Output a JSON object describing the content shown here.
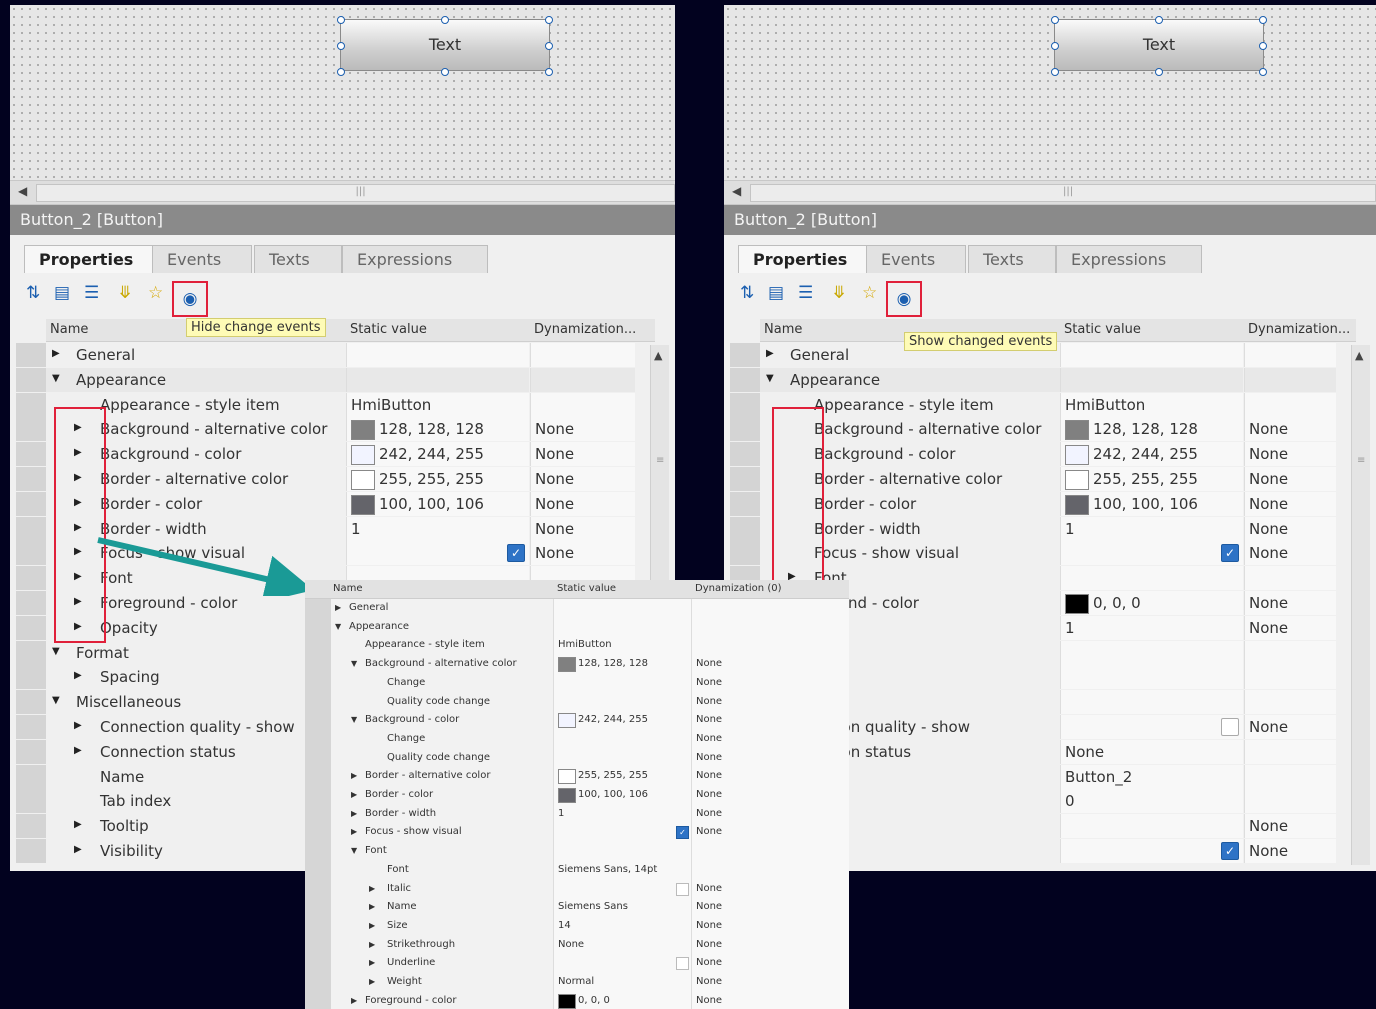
{
  "editor": {
    "widget_text": "Text",
    "title": "Button_2 [Button]",
    "tabs": [
      "Properties",
      "Events",
      "Texts",
      "Expressions"
    ],
    "columns": {
      "name": "Name",
      "static": "Static value",
      "dyn": "Dynamization..."
    }
  },
  "left": {
    "tooltip": "Hide change events",
    "rows": [
      {
        "indent": 0,
        "tri": "right",
        "name": "General",
        "swatch": "",
        "value": "",
        "check": "",
        "dyn": ""
      },
      {
        "indent": 0,
        "tri": "down",
        "name": "Appearance",
        "swatch": "",
        "value": "",
        "check": "",
        "dyn": "",
        "sel": true
      },
      {
        "indent": 1,
        "tri": "",
        "name": "Appearance - style item",
        "swatch": "",
        "value": "HmiButton",
        "check": "",
        "dyn": ""
      },
      {
        "indent": 1,
        "tri": "right",
        "name": "Background - alternative color",
        "swatch": "#808080",
        "value": "128, 128, 128",
        "check": "",
        "dyn": "None"
      },
      {
        "indent": 1,
        "tri": "right",
        "name": "Background - color",
        "swatch": "#f2f4ff",
        "value": "242, 244, 255",
        "check": "",
        "dyn": "None"
      },
      {
        "indent": 1,
        "tri": "right",
        "name": "Border - alternative color",
        "swatch": "#ffffff",
        "value": "255, 255, 255",
        "check": "",
        "dyn": "None"
      },
      {
        "indent": 1,
        "tri": "right",
        "name": "Border - color",
        "swatch": "#64646a",
        "value": "100, 100, 106",
        "check": "",
        "dyn": "None"
      },
      {
        "indent": 1,
        "tri": "right",
        "name": "Border - width",
        "swatch": "",
        "value": "1",
        "check": "",
        "dyn": "None"
      },
      {
        "indent": 1,
        "tri": "right",
        "name": "Focus - show visual",
        "swatch": "",
        "value": "",
        "check": "on",
        "dyn": "None"
      },
      {
        "indent": 1,
        "tri": "right",
        "name": "Font",
        "swatch": "",
        "value": "",
        "check": "",
        "dyn": ""
      },
      {
        "indent": 1,
        "tri": "right",
        "name": "Foreground - color",
        "swatch": "",
        "value": "",
        "check": "",
        "dyn": ""
      },
      {
        "indent": 1,
        "tri": "right",
        "name": "Opacity",
        "swatch": "",
        "value": "",
        "check": "",
        "dyn": ""
      },
      {
        "indent": 0,
        "tri": "down",
        "name": "Format",
        "swatch": "",
        "value": "",
        "check": "",
        "dyn": ""
      },
      {
        "indent": 1,
        "tri": "right",
        "name": "Spacing",
        "swatch": "",
        "value": "",
        "check": "",
        "dyn": ""
      },
      {
        "indent": 0,
        "tri": "down",
        "name": "Miscellaneous",
        "swatch": "",
        "value": "",
        "check": "",
        "dyn": ""
      },
      {
        "indent": 1,
        "tri": "right",
        "name": "Connection quality - show",
        "swatch": "",
        "value": "",
        "check": "",
        "dyn": ""
      },
      {
        "indent": 1,
        "tri": "right",
        "name": "Connection status",
        "swatch": "",
        "value": "",
        "check": "",
        "dyn": ""
      },
      {
        "indent": 1,
        "tri": "",
        "name": "Name",
        "swatch": "",
        "value": "",
        "check": "",
        "dyn": ""
      },
      {
        "indent": 1,
        "tri": "",
        "name": "Tab index",
        "swatch": "",
        "value": "",
        "check": "",
        "dyn": ""
      },
      {
        "indent": 1,
        "tri": "right",
        "name": "Tooltip",
        "swatch": "",
        "value": "",
        "check": "",
        "dyn": ""
      },
      {
        "indent": 1,
        "tri": "right",
        "name": "Visibility",
        "swatch": "",
        "value": "",
        "check": "",
        "dyn": ""
      }
    ]
  },
  "right": {
    "tooltip": "Show changed events",
    "rows": [
      {
        "indent": 0,
        "tri": "right",
        "name": "General",
        "swatch": "",
        "value": "",
        "check": "",
        "dyn": ""
      },
      {
        "indent": 0,
        "tri": "down",
        "name": "Appearance",
        "swatch": "",
        "value": "",
        "check": "",
        "dyn": "",
        "sel": true
      },
      {
        "indent": 1,
        "tri": "",
        "name": "Appearance - style item",
        "swatch": "",
        "value": "HmiButton",
        "check": "",
        "dyn": ""
      },
      {
        "indent": 1,
        "tri": "",
        "name": "Background - alternative color",
        "swatch": "#808080",
        "value": "128, 128, 128",
        "check": "",
        "dyn": "None"
      },
      {
        "indent": 1,
        "tri": "",
        "name": "Background - color",
        "swatch": "#f2f4ff",
        "value": "242, 244, 255",
        "check": "",
        "dyn": "None"
      },
      {
        "indent": 1,
        "tri": "",
        "name": "Border - alternative color",
        "swatch": "#ffffff",
        "value": "255, 255, 255",
        "check": "",
        "dyn": "None"
      },
      {
        "indent": 1,
        "tri": "",
        "name": "Border - color",
        "swatch": "#64646a",
        "value": "100, 100, 106",
        "check": "",
        "dyn": "None"
      },
      {
        "indent": 1,
        "tri": "",
        "name": "Border - width",
        "swatch": "",
        "value": "1",
        "check": "",
        "dyn": "None"
      },
      {
        "indent": 1,
        "tri": "",
        "name": "Focus - show visual",
        "swatch": "",
        "value": "",
        "check": "on",
        "dyn": "None"
      },
      {
        "indent": 1,
        "tri": "right",
        "name": "Font",
        "swatch": "",
        "value": "",
        "check": "",
        "dyn": ""
      },
      {
        "indent": 1,
        "tri": "",
        "name": "ground - color",
        "swatch": "#000000",
        "value": "0, 0, 0",
        "check": "",
        "dyn": "None"
      },
      {
        "indent": 1,
        "tri": "",
        "name": "ity",
        "swatch": "",
        "value": "1",
        "check": "",
        "dyn": "None"
      },
      {
        "indent": 1,
        "tri": "",
        "name": "",
        "swatch": "",
        "value": "",
        "check": "",
        "dyn": ""
      },
      {
        "indent": 1,
        "tri": "",
        "name": "ng",
        "swatch": "",
        "value": "",
        "check": "",
        "dyn": ""
      },
      {
        "indent": 1,
        "tri": "",
        "name": "eous",
        "swatch": "",
        "value": "",
        "check": "",
        "dyn": ""
      },
      {
        "indent": 1,
        "tri": "",
        "name": "ection quality - show",
        "swatch": "",
        "value": "",
        "check": "off",
        "dyn": "None"
      },
      {
        "indent": 1,
        "tri": "",
        "name": "ection status",
        "swatch": "",
        "value": "None",
        "check": "",
        "dyn": ""
      },
      {
        "indent": 1,
        "tri": "",
        "name": "",
        "swatch": "",
        "value": "Button_2",
        "check": "",
        "dyn": ""
      },
      {
        "indent": 1,
        "tri": "",
        "name": "dex",
        "swatch": "",
        "value": "0",
        "check": "",
        "dyn": ""
      },
      {
        "indent": 1,
        "tri": "",
        "name": "p",
        "swatch": "",
        "value": "",
        "check": "",
        "dyn": "None"
      },
      {
        "indent": 1,
        "tri": "",
        "name": "lity",
        "swatch": "",
        "value": "",
        "check": "on",
        "dyn": "None"
      }
    ]
  },
  "zoom": {
    "columns": {
      "name": "Name",
      "static": "Static value",
      "dyn": "Dynamization (0)"
    },
    "rows": [
      {
        "indent": 0,
        "tri": "right",
        "name": "General",
        "swatch": "",
        "value": "",
        "check": "",
        "dyn": ""
      },
      {
        "indent": 0,
        "tri": "down",
        "name": "Appearance",
        "swatch": "",
        "value": "",
        "check": "",
        "dyn": ""
      },
      {
        "indent": 1,
        "tri": "",
        "name": "Appearance - style item",
        "swatch": "",
        "value": "HmiButton",
        "check": "",
        "dyn": ""
      },
      {
        "indent": 1,
        "tri": "down",
        "name": "Background - alternative color",
        "swatch": "#808080",
        "value": "128, 128, 128",
        "check": "",
        "dyn": "None"
      },
      {
        "indent": 2,
        "tri": "",
        "name": "Change",
        "swatch": "",
        "value": "",
        "check": "",
        "dyn": "None"
      },
      {
        "indent": 2,
        "tri": "",
        "name": "Quality code change",
        "swatch": "",
        "value": "",
        "check": "",
        "dyn": "None"
      },
      {
        "indent": 1,
        "tri": "down",
        "name": "Background - color",
        "swatch": "#f2f4ff",
        "value": "242, 244, 255",
        "check": "",
        "dyn": "None"
      },
      {
        "indent": 2,
        "tri": "",
        "name": "Change",
        "swatch": "",
        "value": "",
        "check": "",
        "dyn": "None"
      },
      {
        "indent": 2,
        "tri": "",
        "name": "Quality code change",
        "swatch": "",
        "value": "",
        "check": "",
        "dyn": "None"
      },
      {
        "indent": 1,
        "tri": "right",
        "name": "Border - alternative color",
        "swatch": "#ffffff",
        "value": "255, 255, 255",
        "check": "",
        "dyn": "None"
      },
      {
        "indent": 1,
        "tri": "right",
        "name": "Border - color",
        "swatch": "#64646a",
        "value": "100, 100, 106",
        "check": "",
        "dyn": "None"
      },
      {
        "indent": 1,
        "tri": "right",
        "name": "Border - width",
        "swatch": "",
        "value": "1",
        "check": "",
        "dyn": "None"
      },
      {
        "indent": 1,
        "tri": "right",
        "name": "Focus - show visual",
        "swatch": "",
        "value": "",
        "check": "on",
        "dyn": "None"
      },
      {
        "indent": 1,
        "tri": "down",
        "name": "Font",
        "swatch": "",
        "value": "",
        "check": "",
        "dyn": ""
      },
      {
        "indent": 2,
        "tri": "",
        "name": "Font",
        "swatch": "",
        "value": "Siemens Sans, 14pt",
        "check": "",
        "dyn": ""
      },
      {
        "indent": 2,
        "tri": "right",
        "name": "Italic",
        "swatch": "",
        "value": "",
        "check": "off",
        "dyn": "None"
      },
      {
        "indent": 2,
        "tri": "right",
        "name": "Name",
        "swatch": "",
        "value": "Siemens Sans",
        "check": "",
        "dyn": "None"
      },
      {
        "indent": 2,
        "tri": "right",
        "name": "Size",
        "swatch": "",
        "value": "14",
        "check": "",
        "dyn": "None"
      },
      {
        "indent": 2,
        "tri": "right",
        "name": "Strikethrough",
        "swatch": "",
        "value": "None",
        "check": "",
        "dyn": "None"
      },
      {
        "indent": 2,
        "tri": "right",
        "name": "Underline",
        "swatch": "",
        "value": "",
        "check": "off",
        "dyn": "None"
      },
      {
        "indent": 2,
        "tri": "right",
        "name": "Weight",
        "swatch": "",
        "value": "Normal",
        "check": "",
        "dyn": "None"
      },
      {
        "indent": 1,
        "tri": "right",
        "name": "Foreground - color",
        "swatch": "#000000",
        "value": "0, 0, 0",
        "check": "",
        "dyn": "None"
      }
    ]
  },
  "icons": [
    "sort-icon",
    "categorize-icon",
    "list-icon",
    "filter-icon",
    "favorites-icon",
    "eye-icon"
  ],
  "colors": {
    "highlight": "#e0203a",
    "arrow": "#1a9a96",
    "tooltip": "#fefbb6"
  }
}
